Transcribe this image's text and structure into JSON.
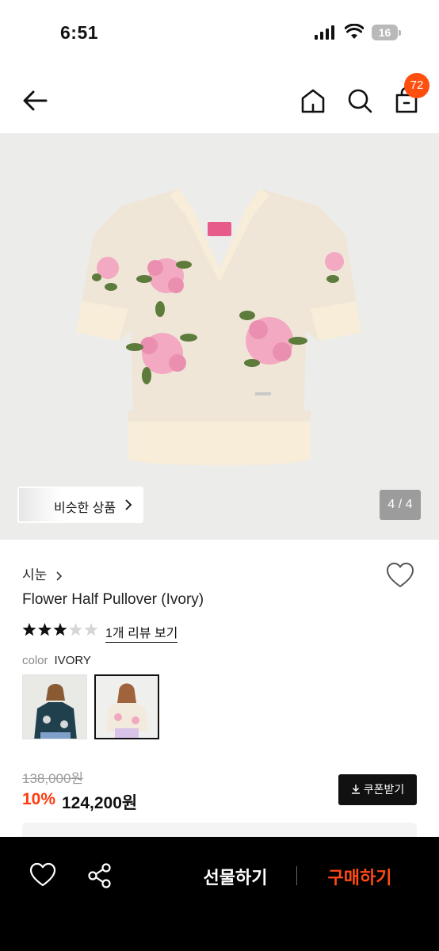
{
  "status_bar": {
    "time": "6:51",
    "battery": "16"
  },
  "header": {
    "back_icon": "arrow-left-icon",
    "home_icon": "home-icon",
    "search_icon": "search-icon",
    "bag_icon": "shopping-bag-icon",
    "cart_count": "72"
  },
  "gallery": {
    "similar_label": "비슷한 상품",
    "page_indicator": "4 / 4",
    "current_page": 4,
    "total_pages": 4
  },
  "product": {
    "brand": "시눈",
    "name": "Flower Half Pullover (Ivory)",
    "rating": 3,
    "rating_max": 5,
    "review_link": "1개 리뷰 보기",
    "color_label": "color",
    "color_value": "IVORY",
    "swatches": [
      {
        "color": "navy",
        "selected": false
      },
      {
        "color": "ivory",
        "selected": true
      }
    ]
  },
  "price": {
    "original": "138,000원",
    "discount": "10%",
    "final": "124,200원",
    "coupon_label": "쿠폰받기"
  },
  "bottom_bar": {
    "wish_icon": "heart-icon",
    "share_icon": "share-icon",
    "gift_label": "선물하기",
    "buy_label": "구매하기"
  },
  "colors": {
    "accent": "#ff4f0f",
    "discount": "#ff3b0f",
    "buy": "#ff4a14",
    "bottom_bar_bg": "#000000"
  }
}
